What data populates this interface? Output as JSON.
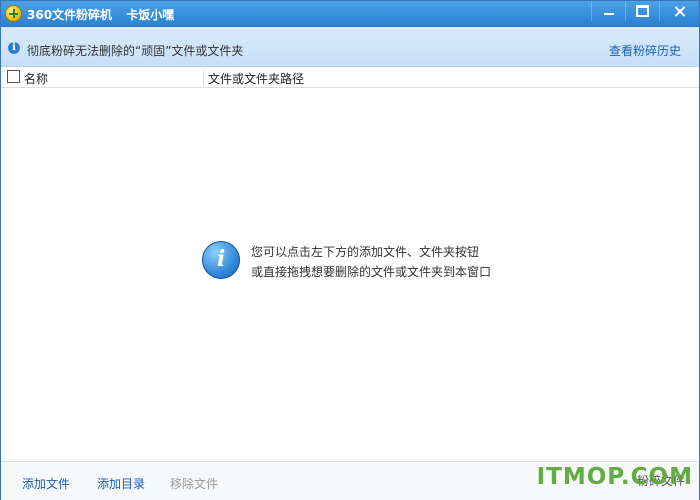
{
  "window": {
    "title_parts": [
      "360文件粉碎机",
      "卡饭小嘿"
    ]
  },
  "infobar": {
    "text": "彻底粉碎无法删除的“顽固”文件或文件夹",
    "history_link": "查看粉碎历史"
  },
  "list": {
    "columns": [
      "名称",
      "文件或文件夹路径"
    ],
    "empty_hint": [
      "您可以点击左下方的添加文件、文件夹按钮",
      "或直接拖拽想要删除的文件或文件夹到本窗口"
    ]
  },
  "footer": {
    "add_file": "添加文件",
    "add_folder": "添加目录",
    "remove_file": "移除文件",
    "shred": "粉碎文件"
  },
  "watermark": "ITMOP.COM",
  "icons": {
    "app": "360-shredder-logo",
    "info": "info-icon",
    "minimize": "minimize-icon",
    "maximize": "maximize-icon",
    "close": "close-icon"
  },
  "colors": {
    "titlebar": "#2b7fd0",
    "link": "#1a5fb4",
    "watermark": "#5aa93a"
  }
}
